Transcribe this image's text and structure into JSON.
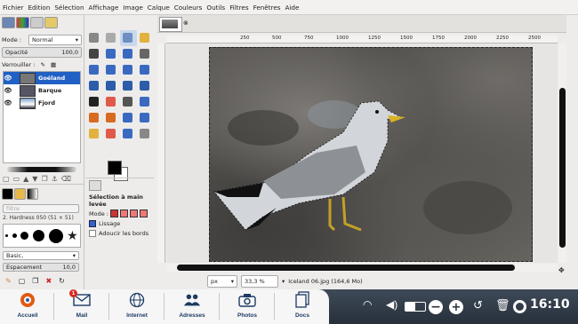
{
  "menu": [
    "Fichier",
    "Edition",
    "Sélection",
    "Affichage",
    "Image",
    "Calque",
    "Couleurs",
    "Outils",
    "Filtres",
    "Fenêtres",
    "Aide"
  ],
  "layers_panel": {
    "mode_label": "Mode :",
    "mode_value": "Normal",
    "opacity_label": "Opacité",
    "opacity_value": "100,0",
    "lock_label": "Verrouiller :",
    "layers": [
      {
        "name": "Goéland",
        "selected": true
      },
      {
        "name": "Barque",
        "selected": false
      },
      {
        "name": "Fjord",
        "selected": false
      }
    ]
  },
  "brushes_panel": {
    "filter_placeholder": "filtre",
    "brush_name": "2. Hardness 050 (51 × 51)",
    "preset": "Basic,",
    "spacing_label": "Espacement",
    "spacing_value": "10,0"
  },
  "tool_options": {
    "title": "Sélection à main levée",
    "mode_label": "Mode :",
    "antialias_label": "Lissage",
    "feather_label": "Adoucir les bords"
  },
  "rulers": {
    "h_ticks": [
      "250",
      "500",
      "750",
      "1000",
      "1250",
      "1500",
      "1750",
      "2000",
      "2250",
      "2500"
    ]
  },
  "status": {
    "unit": "px",
    "zoom": "33,3 %",
    "file_info": "Iceland 06.jpg (164,6 Mo)"
  },
  "taskbar": {
    "items": [
      "Accueil",
      "Mail",
      "Internet",
      "Adresses",
      "Photos",
      "Docs"
    ],
    "mail_badge": "1",
    "clock": "16:10"
  },
  "icons": {
    "tray": [
      "wifi-icon",
      "volume-icon",
      "battery-icon",
      "minus-icon",
      "plus-icon",
      "rotate-icon",
      "trash-icon",
      "lifebuoy-icon"
    ]
  },
  "colors": {
    "accent": "#2160c4",
    "taskbar_text": "#1d3b64",
    "taskbar_bg": "#27303b"
  }
}
